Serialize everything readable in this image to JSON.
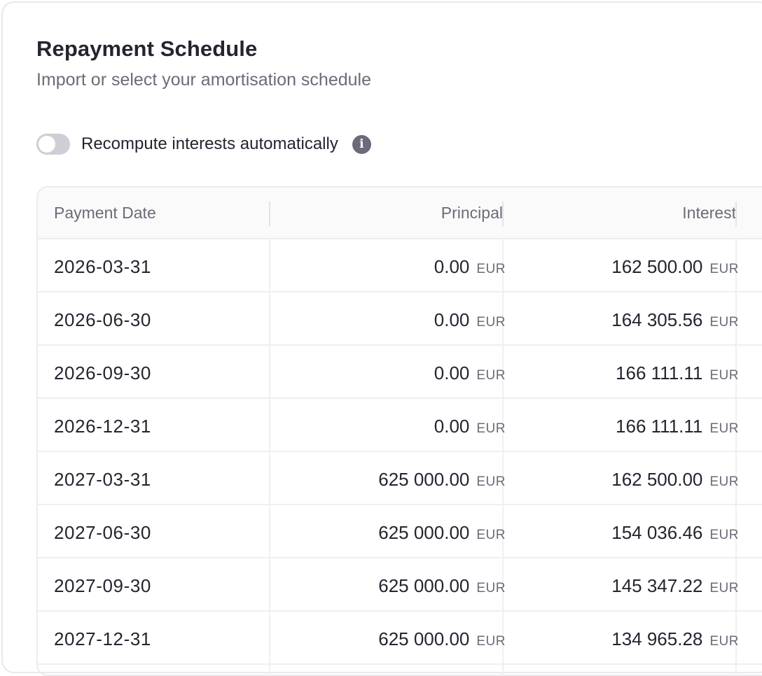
{
  "title": "Repayment Schedule",
  "subtitle": "Import or select your amortisation schedule",
  "toggle": {
    "label": "Recompute interests automatically",
    "enabled": false,
    "info_icon": "info-icon"
  },
  "table": {
    "headers": {
      "date": "Payment Date",
      "principal": "Principal",
      "interest": "Interest"
    },
    "rows": [
      {
        "date": "2026-03-31",
        "principal": "0.00",
        "principal_currency": "EUR",
        "interest": "162 500.00",
        "interest_currency": "EUR"
      },
      {
        "date": "2026-06-30",
        "principal": "0.00",
        "principal_currency": "EUR",
        "interest": "164 305.56",
        "interest_currency": "EUR"
      },
      {
        "date": "2026-09-30",
        "principal": "0.00",
        "principal_currency": "EUR",
        "interest": "166 111.11",
        "interest_currency": "EUR"
      },
      {
        "date": "2026-12-31",
        "principal": "0.00",
        "principal_currency": "EUR",
        "interest": "166 111.11",
        "interest_currency": "EUR"
      },
      {
        "date": "2027-03-31",
        "principal": "625 000.00",
        "principal_currency": "EUR",
        "interest": "162 500.00",
        "interest_currency": "EUR"
      },
      {
        "date": "2027-06-30",
        "principal": "625 000.00",
        "principal_currency": "EUR",
        "interest": "154 036.46",
        "interest_currency": "EUR"
      },
      {
        "date": "2027-09-30",
        "principal": "625 000.00",
        "principal_currency": "EUR",
        "interest": "145 347.22",
        "interest_currency": "EUR"
      },
      {
        "date": "2027-12-31",
        "principal": "625 000.00",
        "principal_currency": "EUR",
        "interest": "134 965.28",
        "interest_currency": "EUR"
      }
    ]
  },
  "colors": {
    "text": "#27232f",
    "muted": "#6e6a78",
    "border": "#ecebef",
    "toggle_off": "#cfcdd5",
    "info_icon_bg": "#6d6a7c"
  }
}
